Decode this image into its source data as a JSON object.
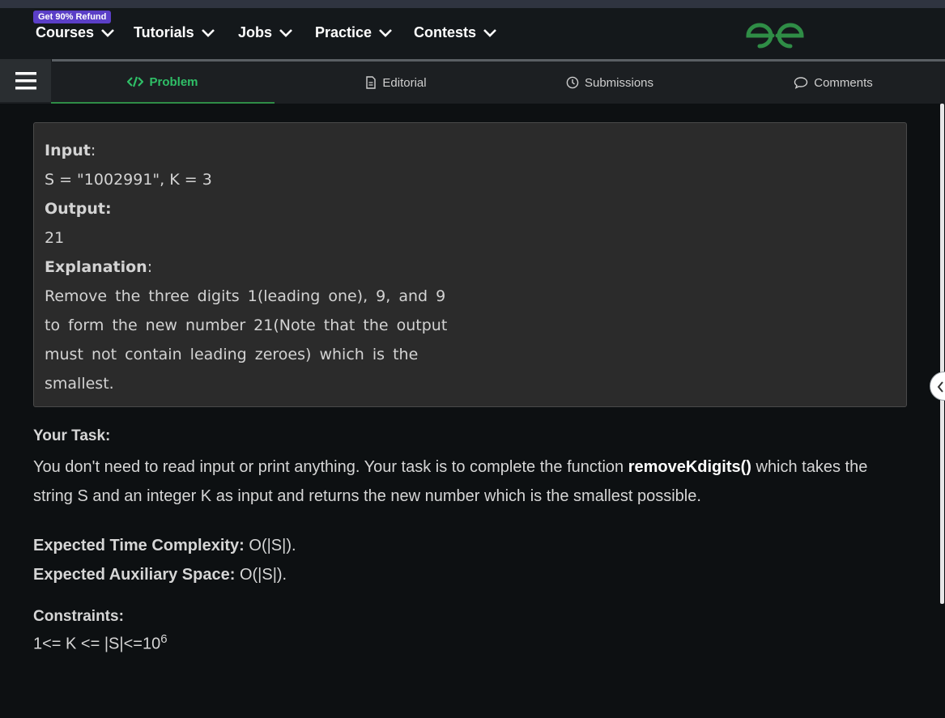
{
  "nav": {
    "badge": "Get 90% Refund",
    "items": [
      "Courses",
      "Tutorials",
      "Jobs",
      "Practice",
      "Contests"
    ]
  },
  "tabs": {
    "problem": "Problem",
    "editorial": "Editorial",
    "submissions": "Submissions",
    "comments": "Comments"
  },
  "example": {
    "input_label": "Input",
    "input_value": "S = \"1002991\", K = 3",
    "output_label": "Output:",
    "output_value": "21",
    "explanation_label": "Explanation",
    "explanation_text": "Remove the three digits 1(leading one), 9, and 9 to form the new number 21(Note that the output must not contain leading zeroes) which is the smallest."
  },
  "task": {
    "heading": "Your Task:",
    "text_before": "You don't need to read input or print anything. Your task is to complete the function ",
    "function_name": "removeKdigits()",
    "text_after": " which takes the string S and an integer K as input and returns the new number which is the smallest possible."
  },
  "complexity": {
    "time_label": "Expected Time Complexity:",
    "time_value": "O(|S|).",
    "space_label": "Expected Auxiliary Space:",
    "space_value": "O(|S|)."
  },
  "constraints": {
    "heading": "Constraints:",
    "text": "1<= K <= |S|<=10",
    "exponent": "6"
  },
  "colors": {
    "accent_green": "#2f8d46",
    "badge_purple": "#5b3fc7"
  }
}
